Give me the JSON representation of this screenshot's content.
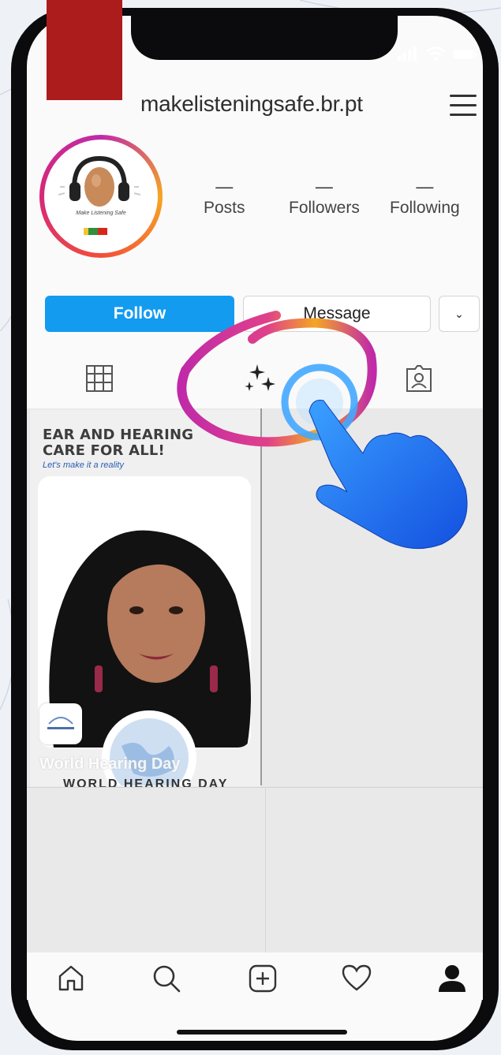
{
  "profile": {
    "username": "makelisteningsafe.br.pt",
    "avatar_caption": "Make Listening Safe"
  },
  "stats": [
    {
      "value": "—",
      "label": "Posts"
    },
    {
      "value": "—",
      "label": "Followers"
    },
    {
      "value": "—",
      "label": "Following"
    }
  ],
  "actions": {
    "follow_label": "Follow",
    "message_label": "Message",
    "more_label": "⌄"
  },
  "tabs": [
    {
      "icon": "grid-icon"
    },
    {
      "icon": "sparkles-icon"
    },
    {
      "icon": "tagged-icon"
    }
  ],
  "post": {
    "headline": "EAR AND HEARING\nCARE FOR ALL!",
    "subline": "Let's make it a reality",
    "footer_faint": "World Hearing Day",
    "footer": "WORLD HEARING DAY"
  },
  "nav": [
    {
      "icon": "home-icon"
    },
    {
      "icon": "search-icon"
    },
    {
      "icon": "add-post-icon"
    },
    {
      "icon": "heart-icon"
    },
    {
      "icon": "profile-icon"
    }
  ],
  "colors": {
    "follow_button": "#139bf0",
    "red_block": "#ad1c1c",
    "hand_blue": "#1877f2",
    "circle_gradient_start": "#f5a623",
    "circle_gradient_end": "#c02aa8"
  }
}
